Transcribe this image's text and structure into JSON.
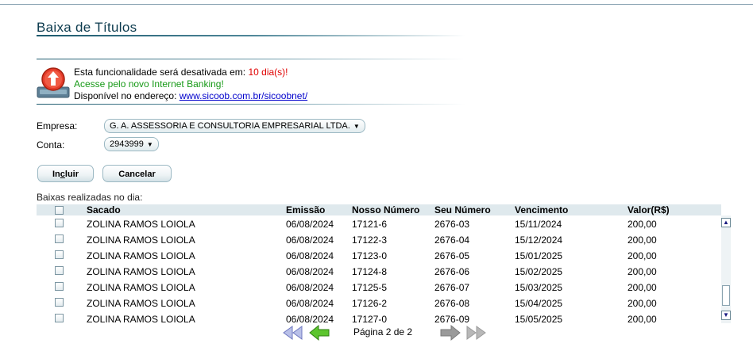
{
  "page": {
    "title": "Baixa de Títulos"
  },
  "notice": {
    "line1_prefix": "Esta funcionalidade será desativada em: ",
    "line1_days": "10 dia(s)!",
    "line2": "Acesse pelo novo Internet Banking!",
    "line3_prefix": "Disponível no endereço: ",
    "line3_link": "www.sicoob.com.br/sicoobnet/",
    "icon": "warning-upload-icon"
  },
  "form": {
    "empresa_label": "Empresa:",
    "empresa_value": "G. A. ASSESSORIA E CONSULTORIA EMPRESARIAL LTDA.",
    "conta_label": "Conta:",
    "conta_value": "2943999"
  },
  "buttons": {
    "incluir_prefix": "In",
    "incluir_underlined": "c",
    "incluir_suffix": "luir",
    "cancelar": "Cancelar"
  },
  "grid": {
    "caption": "Baixas realizadas no dia:",
    "columns": [
      "Sacado",
      "Emissão",
      "Nosso Número",
      "Seu Número",
      "Vencimento",
      "Valor(R$)"
    ],
    "rows": [
      [
        "ZOLINA RAMOS LOIOLA",
        "06/08/2024",
        "17121-6",
        "2676-03",
        "15/11/2024",
        "200,00"
      ],
      [
        "ZOLINA RAMOS LOIOLA",
        "06/08/2024",
        "17122-3",
        "2676-04",
        "15/12/2024",
        "200,00"
      ],
      [
        "ZOLINA RAMOS LOIOLA",
        "06/08/2024",
        "17123-0",
        "2676-05",
        "15/01/2025",
        "200,00"
      ],
      [
        "ZOLINA RAMOS LOIOLA",
        "06/08/2024",
        "17124-8",
        "2676-06",
        "15/02/2025",
        "200,00"
      ],
      [
        "ZOLINA RAMOS LOIOLA",
        "06/08/2024",
        "17125-5",
        "2676-07",
        "15/03/2025",
        "200,00"
      ],
      [
        "ZOLINA RAMOS LOIOLA",
        "06/08/2024",
        "17126-2",
        "2676-08",
        "15/04/2025",
        "200,00"
      ],
      [
        "ZOLINA RAMOS LOIOLA",
        "06/08/2024",
        "17127-0",
        "2676-09",
        "15/05/2025",
        "200,00"
      ]
    ]
  },
  "pager": {
    "text": "Página 2 de 2"
  },
  "colors": {
    "title": "#0b3a4d",
    "accent": "#1d5a6e",
    "warning_red": "#e00000",
    "green": "#189a18",
    "link": "#0000cc"
  }
}
